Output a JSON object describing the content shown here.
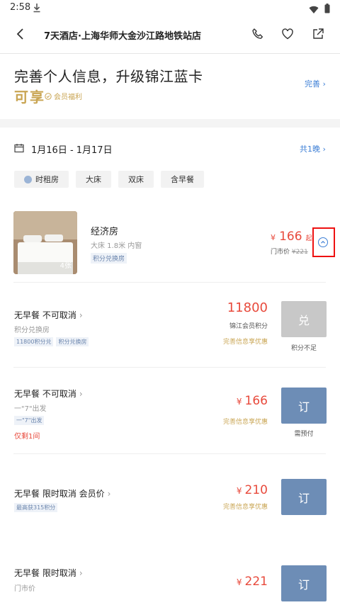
{
  "status_bar": {
    "time": "2:58"
  },
  "nav": {
    "title": "7天酒店·上海华师大金沙江路地铁站店"
  },
  "promo": {
    "headline": "完善个人信息，升级锦江蓝卡",
    "highlight": "可享",
    "benefit": "会员福利",
    "action": "完善"
  },
  "stay": {
    "dates": "1月16日 - 1月17日",
    "nights": "共1晚"
  },
  "filters": [
    "时租房",
    "大床",
    "双床",
    "含早餐"
  ],
  "room": {
    "photo_count": "4张",
    "name": "经济房",
    "spec": "大床 1.8米   内窗",
    "tag": "积分兑换房",
    "price_symbol": "¥",
    "price": "166",
    "price_suffix": "起",
    "orig_label": "门市价",
    "orig_price": "¥221"
  },
  "rates": [
    {
      "title": "无早餐  不可取消",
      "sub": "积分兑换房",
      "tags": [
        "11800积分兑",
        "积分兑换房"
      ],
      "price": "11800",
      "note": "锦江会员积分",
      "offer": "完善信息享优惠",
      "button": "兑",
      "button_note": "积分不足"
    },
    {
      "title": "无早餐  不可取消",
      "sub": "一\"7\"出发",
      "tags": [
        "一\"7\"出发"
      ],
      "warn": "仅剩1间",
      "currency": "¥",
      "price": "166",
      "offer": "完善信息享优惠",
      "button": "订",
      "button_note": "需预付"
    },
    {
      "title": "无早餐  限时取消  会员价",
      "tags": [
        "最高获315积分"
      ],
      "currency": "¥",
      "price": "210",
      "offer": "完善信息享优惠",
      "button": "订"
    },
    {
      "title": "无早餐  限时取消",
      "sub": "门市价",
      "currency": "¥",
      "price": "221",
      "button": "订"
    }
  ],
  "colors": {
    "accent_blue": "#3d7fd6",
    "price_red": "#e84a3c",
    "gold": "#c9a553",
    "book_button": "#6d8db6"
  }
}
